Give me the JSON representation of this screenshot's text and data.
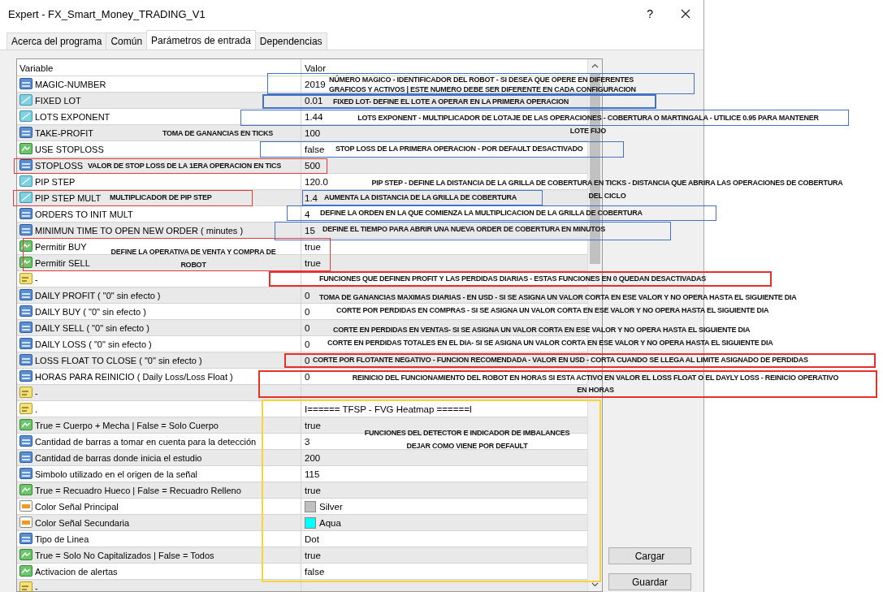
{
  "window": {
    "title": "Expert - FX_Smart_Money_TRADING_V1",
    "help": "?"
  },
  "tabs": [
    {
      "label": "Acerca del programa",
      "selected": false
    },
    {
      "label": "Común",
      "selected": false
    },
    {
      "label": "Parámetros de entrada",
      "selected": true
    },
    {
      "label": "Dependencias",
      "selected": false
    }
  ],
  "table": {
    "columns": [
      "Variable",
      "Valor"
    ],
    "rows": [
      {
        "kind": "int",
        "name": "MAGIC-NUMBER",
        "value": "2019"
      },
      {
        "kind": "double",
        "name": "FIXED LOT",
        "value": "0.01"
      },
      {
        "kind": "double",
        "name": "LOTS EXPONENT",
        "value": "1.44"
      },
      {
        "kind": "int",
        "name": "TAKE-PROFIT",
        "value": "100"
      },
      {
        "kind": "bool",
        "name": "USE STOPLOSS",
        "value": "false"
      },
      {
        "kind": "int",
        "name": "STOPLOSS",
        "value": "500"
      },
      {
        "kind": "double",
        "name": "PIP STEP",
        "value": "120.0"
      },
      {
        "kind": "double",
        "name": "PIP STEP MULT",
        "value": "1.4"
      },
      {
        "kind": "int",
        "name": "ORDERS TO INIT MULT",
        "value": "4"
      },
      {
        "kind": "int",
        "name": "MINIMUN TIME TO OPEN NEW ORDER ( minutes )",
        "value": "15"
      },
      {
        "kind": "bool",
        "name": "Permitir BUY",
        "value": "true"
      },
      {
        "kind": "bool",
        "name": "Permitir SELL",
        "value": "true"
      },
      {
        "kind": "string",
        "name": "-"
      },
      {
        "kind": "int",
        "name": "DAILY PROFIT ( \"0\" sin efecto )",
        "value": "0"
      },
      {
        "kind": "int",
        "name": "DAILY BUY ( \"0\" sin efecto )",
        "value": "0"
      },
      {
        "kind": "int",
        "name": "DAILY SELL ( \"0\" sin efecto )",
        "value": "0"
      },
      {
        "kind": "int",
        "name": "DAILY LOSS ( \"0\" sin efecto )",
        "value": "0"
      },
      {
        "kind": "int",
        "name": "LOSS FLOAT TO CLOSE ( \"0\" sin efecto )",
        "value": "0"
      },
      {
        "kind": "int",
        "name": "HORAS PARA REINICIO ( Daily Loss/Loss Float )",
        "value": "0"
      },
      {
        "kind": "string",
        "name": "-"
      },
      {
        "kind": "string",
        "name": ".",
        "value": "I====== TFSP - FVG Heatmap ======I"
      },
      {
        "kind": "bool",
        "name": "True = Cuerpo + Mecha | False = Solo Cuerpo",
        "value": "true"
      },
      {
        "kind": "int",
        "name": "Cantidad de barras a tomar en cuenta para la detección",
        "value": "3"
      },
      {
        "kind": "int",
        "name": "Cantidad de barras donde inicia el estudio",
        "value": "200"
      },
      {
        "kind": "int",
        "name": "Simbolo utilizado en el origen de la señal",
        "value": "115"
      },
      {
        "kind": "bool",
        "name": "True = Recuadro Hueco | False = Recuadro Relleno",
        "value": "true"
      },
      {
        "kind": "color",
        "name": "Color Señal Principal",
        "value": "Silver",
        "color": "#c0c0c0"
      },
      {
        "kind": "color",
        "name": "Color Señal Secundaria",
        "value": "Aqua",
        "color": "#00ffff"
      },
      {
        "kind": "int",
        "name": "Tipo de Linea",
        "value": "Dot"
      },
      {
        "kind": "bool",
        "name": "True = Solo No Capitalizados | False = Todos",
        "value": "true"
      },
      {
        "kind": "bool",
        "name": "Activacion de alertas",
        "value": "false"
      },
      {
        "kind": "string",
        "name": "-"
      }
    ]
  },
  "buttons": [
    "Cargar",
    "Guardar"
  ],
  "annotations": [
    {
      "lines": [
        "NÚMERO MAGICO - IDENTIFICADOR DEL ROBOT - SI DESEA QUE OPERE EN DIFERENTES",
        "GRAFICOS Y ACTIVOS | ESTE NUMERO DEBE SER DIFERENTE EN CADA CONFIGURACION"
      ],
      "color": "#4472c4"
    },
    {
      "lines": [
        "FIXED LOT- DEFINE EL LOTE A OPERAR EN LA PRIMERA OPERACION"
      ],
      "color": "#4472c4"
    },
    {
      "lines": [
        "LOTS EXPONENT - MULTIPLICADOR DE LOTAJE DE LAS OPERACIONES - COBERTURA O MARTINGALA - UTILICE  0.95 PARA MANTENER",
        "LOTE FIJO"
      ],
      "color": "#4472c4"
    },
    {
      "lines": [
        "TOMA DE GANANCIAS EN TICKS"
      ]
    },
    {
      "lines": [
        "STOP LOSS DE LA PRIMERA OPERACION - POR DEFAULT DESACTIVADO"
      ],
      "color": "#4472c4"
    },
    {
      "lines": [
        "VALOR DE STOP LOSS DE LA 1ERA OPERACION EN TICS"
      ],
      "color": "#e03c3c"
    },
    {
      "lines": [
        "MULTIPLICADOR DE PIP STEP"
      ],
      "color": "#e03c3c"
    },
    {
      "lines": [
        "PIP STEP - DEFINE LA DISTANCIA DE LA GRILLA DE COBERTURA EN TICKS - DISTANCIA QUE ABRIRA LAS OPERACIONES DE COBERTURA",
        "DEL CICLO"
      ]
    },
    {
      "lines": [
        "AUMENTA LA DISTANCIA DE LA GRILLA DE COBERTURA"
      ],
      "color": "#4472c4"
    },
    {
      "lines": [
        "DEFINE LA ORDEN EN LA QUE COMIENZA LA MULTIPLICACION DE LA GRILLA DE COBERTURA"
      ],
      "color": "#4472c4"
    },
    {
      "lines": [
        "DEFINE EL TIEMPO PARA ABRIR UNA NUEVA ORDER DE COBERTURA EN MINUTOS"
      ],
      "color": "#4472c4"
    },
    {
      "lines": [
        "DEFINE LA OPERATIVA DE VENTA Y COMPRA DE",
        "ROBOT"
      ],
      "color": "#e03c3c"
    },
    {
      "lines": [
        "FUNCIONES QUE DEFINEN PROFIT Y LAS PERDIDAS DIARIAS  - ESTAS FUNCIONES EN 0 QUEDAN DESACTIVADAS"
      ],
      "color": "#e8302a"
    },
    {
      "lines": [
        "TOMA DE GANANCIAS MAXIMAS DIARIAS - EN USD - SI SE ASIGNA UN VALOR CORTA EN ESE  VALOR Y NO OPERA HASTA EL SIGUIENTE DIA"
      ]
    },
    {
      "lines": [
        "CORTE POR PERDIDAS EN COMPRAS - SI SE ASIGNA UN VALOR CORTA EN ESE  VALOR Y NO OPERA HASTA EL SIGUIENTE DIA"
      ]
    },
    {
      "lines": [
        "CORTE EN PERDIDAS EN VENTAS- SI SE ASIGNA UN VALOR CORTA EN ESE  VALOR Y NO OPERA HASTA EL SIGUIENTE DIA"
      ]
    },
    {
      "lines": [
        "CORTE EN PERDIDAS TOTALES EN EL DIA- SI SE ASIGNA UN VALOR CORTA EN ESE  VALOR Y NO OPERA HASTA EL SIGUIENTE DIA"
      ]
    },
    {
      "lines": [
        "CORTE POR FLOTANTE NEGATIVO - FUNCION RECOMENDADA - VALOR EN USD - CORTA CUANDO SE LLEGA AL LIMITE ASIGNADO DE PERDIDAS"
      ],
      "color": "#e8302a"
    },
    {
      "lines": [
        "REINICIO DEL FUNCIONAMIENTO DEL ROBOT EN HORAS SI ESTA ACTIVO EN VALOR EL LOSS FLOAT O EL DAYLY LOSS - REINICIO OPERATIVO",
        "EN HORAS"
      ],
      "color": "#e8302a"
    },
    {
      "lines": [
        "FUNCIONES DEL DETECTOR E INDICADOR DE IMBALANCES",
        "DEJAR COMO VIENE POR DEFAULT"
      ],
      "color": "#f5d33a"
    }
  ]
}
